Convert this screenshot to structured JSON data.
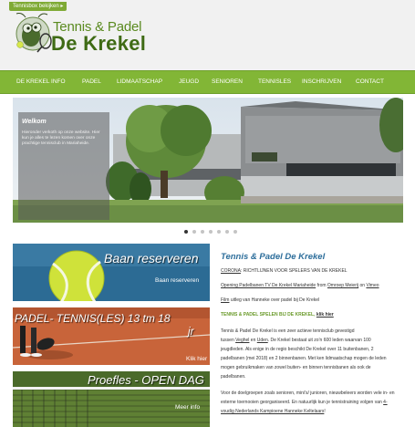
{
  "header": {
    "top_tab": "Tennisbox bekijken ▸",
    "logo_line1": "Tennis & Padel",
    "logo_line2": "De Krekel"
  },
  "nav": {
    "items": [
      "DE KREKEL INFO",
      "PADEL",
      "LIDMAATSCHAP",
      "JEUGD",
      "SENIOREN",
      "TENNISLES",
      "INSCHRIJVEN",
      "CONTACT"
    ]
  },
  "hero": {
    "welcome_title": "Welkom",
    "welcome_text": "Hieronder verkoth op onze website. Hier kun je alles te lezen komen over onze prachtige tennisclub in Mariaheide.",
    "slides_count": 7,
    "active_slide": 1
  },
  "tiles": [
    {
      "title": "Baan reserveren",
      "link": "Baan reserveren"
    },
    {
      "title_line1": "PADEL- TENNIS(LES) 13 tm 18",
      "title_line2": "jr",
      "link": "Klik hier"
    },
    {
      "title": "Proefles - OPEN DAG",
      "link": "Meer info"
    }
  ],
  "content": {
    "title": "Tennis & Padel De Krekel",
    "line1_a": "CORONA",
    "line1_b": ": RICHTLIJNEN VOOR SPELERS VAN DE KREKEL",
    "line2_a": "Opening Padelbanen TV De Krekel Mariaheide",
    "line2_b": " from ",
    "line2_c": "Omroep Meierij",
    "line2_d": " on ",
    "line2_e": "Vimeo",
    "line3_a": "Film",
    "line3_b": " uitleg van Hanneke over padel bij De Krekel",
    "line4_a": "TENNIS & PADEL SPELEN BIJ DE KREKEL",
    "line4_b": ", ",
    "line4_c": "klik hier",
    "para1_l1": "Tennis & Padel De Krekel is een zeer actieve tennisclub gevestigd",
    "para1_l2_a": "tussen ",
    "para1_l2_b": "Veghel",
    "para1_l2_c": " en ",
    "para1_l2_d": "Uden",
    "para1_l2_e": ". De Krekel bestaat uit zo'n 600 leden waarvan 100",
    "para1_l3": "jeugdleden.  Als enige in de regio beschikt De Krekel over 11 buitenbanen, 2",
    "para1_l4": "padelbanen (mei 2018) en 2 binnenbanen. Met ken lidmaatschap mogen de leden",
    "para1_l5": "mogen gebruikmaken van zowel buiten- en binnen tennisbanen als ook de",
    "para1_l6": "padelbanen.",
    "para2_l1": "Voor de doelgroepen zoals senioren, mini's/ junioren, nieuwbeleers worden vele in- en",
    "para2_l2_a": "externe toernooien georganiseerd. En natuurlijk kun je tennistraining volgen van ",
    "para2_l2_b": "4-",
    "para2_l3_a": "voudig Nederlands Kampioene Hanneke Keltelaars",
    "para2_l3_b": "!"
  }
}
